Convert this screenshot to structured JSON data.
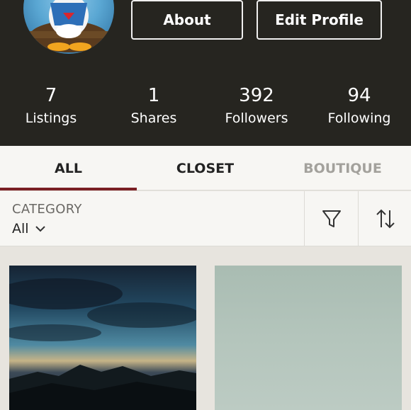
{
  "profile": {
    "about_label": "About",
    "edit_label": "Edit Profile"
  },
  "stats": [
    {
      "value": "7",
      "label": "Listings"
    },
    {
      "value": "1",
      "label": "Shares"
    },
    {
      "value": "392",
      "label": "Followers"
    },
    {
      "value": "94",
      "label": "Following"
    }
  ],
  "tabs": [
    {
      "label": "ALL"
    },
    {
      "label": "CLOSET"
    },
    {
      "label": "BOUTIQUE"
    }
  ],
  "filter": {
    "category_label": "CATEGORY",
    "category_value": "All",
    "filter_icon": "filter-funnel-icon",
    "sort_icon": "sort-arrows-icon"
  },
  "colors": {
    "header_bg": "#262520",
    "accent": "#7a1f24",
    "muted_tab": "#a3a19c"
  }
}
